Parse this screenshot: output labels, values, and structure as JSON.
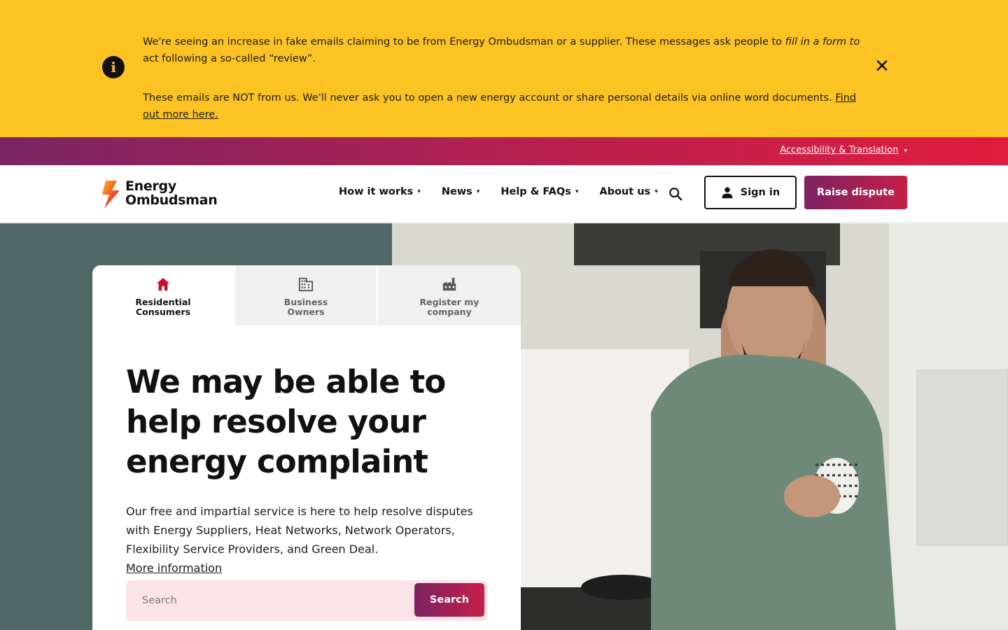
{
  "alert": {
    "p1_a": "We're seeing an increase in fake emails claiming to be from Energy Ombudsman or a supplier. These messages ask people to ",
    "p1_em": "fill in a form to",
    "p1_b": " act following a so-called “review”.",
    "p2_a": "These emails are NOT from us. We'll never ask you to open a new energy account or share personal details via online word documents. ",
    "p2_link": "Find out more here.",
    "info_icon": "i",
    "close_icon": "✕"
  },
  "utility": {
    "accessibility_label": "Accessibility & Translation"
  },
  "header": {
    "logo_line1": "Energy",
    "logo_line2": "Ombudsman",
    "nav": [
      "How it works",
      "News",
      "Help & FAQs",
      "About us"
    ],
    "caret": "▾",
    "signin_label": "Sign in",
    "raise_label": "Raise dispute"
  },
  "hero": {
    "tabs": [
      {
        "line1": "Residential",
        "line2": "Consumers",
        "icon": "house-icon"
      },
      {
        "line1": "Business",
        "line2": "Owners",
        "icon": "building-icon"
      },
      {
        "line1": "Register my",
        "line2": "company",
        "icon": "factory-icon"
      }
    ],
    "title": [
      "We may be able to",
      "help resolve your",
      "energy complaint"
    ],
    "desc_line1": "Our free and impartial service is here to help resolve disputes",
    "desc_line2": "with Energy Suppliers, Heat Networks, Network Operators,",
    "desc_line3": "Flexibility Service Providers, and Green Deal. ",
    "desc_link": "More information",
    "search_placeholder": "Search",
    "search_button": "Search"
  },
  "colors": {
    "alert_yellow": "#fdc323",
    "brand_purple": "#7c2262",
    "brand_red": "#e01d3d",
    "tab_active_icon": "#c8102e"
  }
}
